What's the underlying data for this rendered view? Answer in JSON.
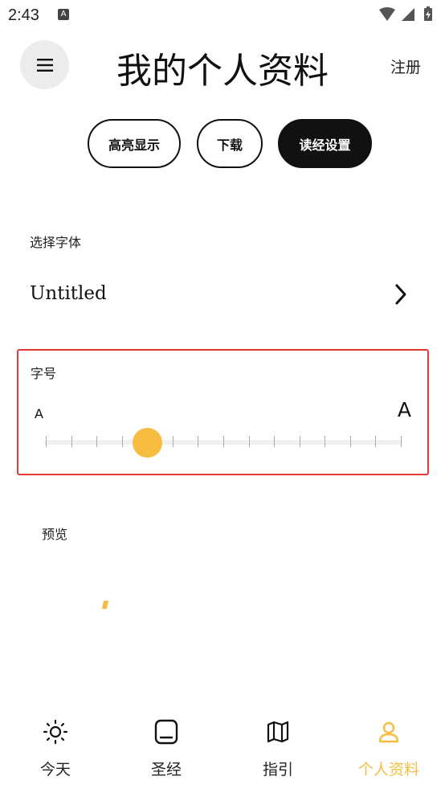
{
  "status_bar": {
    "time": "2:43",
    "notification_badge": "A"
  },
  "header": {
    "title": "我的个人资料",
    "register_label": "注册",
    "menu_icon": "menu-icon"
  },
  "tabs": [
    {
      "label": "高亮显示",
      "active": false
    },
    {
      "label": "下载",
      "active": false
    },
    {
      "label": "读经设置",
      "active": true
    }
  ],
  "font_section": {
    "label": "选择字体",
    "selected_font": "Untitled"
  },
  "size_section": {
    "label": "字号",
    "small_label": "A",
    "large_label": "A",
    "slider_steps": 15,
    "slider_value_index": 4
  },
  "preview": {
    "label": "预览"
  },
  "bottom_nav": [
    {
      "label": "今天",
      "icon": "sun-icon",
      "active": false
    },
    {
      "label": "圣经",
      "icon": "bible-icon",
      "active": false
    },
    {
      "label": "指引",
      "icon": "map-icon",
      "active": false
    },
    {
      "label": "个人资料",
      "icon": "profile-icon",
      "active": true
    }
  ],
  "colors": {
    "accent": "#f7bd41",
    "highlight_border": "#e53935",
    "dark": "#111111"
  }
}
